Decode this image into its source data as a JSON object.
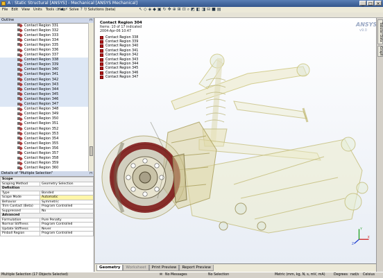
{
  "window": {
    "title": "A : Static Structural [ANSYS] - Mechanical [ANSYS Mechanical]",
    "buttons": [
      "_",
      "□",
      "×"
    ]
  },
  "menubar": [
    "File",
    "Edit",
    "View",
    "Units",
    "Tools",
    "Help"
  ],
  "toolbar": {
    "solve_label": "Solve",
    "solutions_label": "?/ Solutions (beta)"
  },
  "outline": {
    "header": "Outline",
    "items": [
      "Contact Region 331",
      "Contact Region 332",
      "Contact Region 333",
      "Contact Region 334",
      "Contact Region 335",
      "Contact Region 336",
      "Contact Region 337",
      "Contact Region 338",
      "Contact Region 339",
      "Contact Region 340",
      "Contact Region 341",
      "Contact Region 342",
      "Contact Region 343",
      "Contact Region 344",
      "Contact Region 345",
      "Contact Region 346",
      "Contact Region 347",
      "Contact Region 348",
      "Contact Region 349",
      "Contact Region 350",
      "Contact Region 351",
      "Contact Region 352",
      "Contact Region 353",
      "Contact Region 354",
      "Contact Region 355",
      "Contact Region 356",
      "Contact Region 357",
      "Contact Region 358",
      "Contact Region 359",
      "Contact Region 360"
    ],
    "selected_from": 7,
    "selected_to": 16
  },
  "details": {
    "header": "Details of \"Multiple Selection\"",
    "rows": [
      {
        "section": "Scope"
      },
      {
        "k": "Scoping Method",
        "v": "Geometry Selection"
      },
      {
        "section": "Definition"
      },
      {
        "k": "Type",
        "v": "Bonded"
      },
      {
        "k": "Scope Mode",
        "v": "Automatic"
      },
      {
        "k": "Behavior",
        "v": "Symmetric"
      },
      {
        "k": "Trim Contact (Beta)",
        "v": "Program Controlled"
      },
      {
        "k": "Suppressed",
        "v": "No"
      },
      {
        "section": "Advanced"
      },
      {
        "k": "Formulation",
        "v": "Pure Penalty"
      },
      {
        "k": "Normal Stiffness",
        "v": "Program Controlled"
      },
      {
        "k": "Update Stiffness",
        "v": "Never"
      },
      {
        "k": "Pinball Region",
        "v": "Program Controlled"
      }
    ]
  },
  "viewport": {
    "legend_title": "Contact Region 304",
    "legend_sub1": "Items: 10 of 17 indicated",
    "legend_sub2": "2004-Apr-06 10:47",
    "legend_items": [
      "Contact Region 338",
      "Contact Region 339",
      "Contact Region 340",
      "Contact Region 341",
      "Contact Region 342",
      "Contact Region 343",
      "Contact Region 344",
      "Contact Region 345",
      "Contact Region 346",
      "Contact Region 347"
    ],
    "logo": "ANSYS",
    "logo_sub": "v9.0",
    "triad_labels": [
      "X",
      "Y",
      "Z"
    ]
  },
  "right_tabs": [
    "Tabular Data",
    "Graph"
  ],
  "bottom_tabs": [
    "Geometry",
    "Worksheet",
    "Print Preview",
    "Report Preview"
  ],
  "status": {
    "selection": "Multiple Selection (17 Objects Selected)",
    "messages": "No Messages",
    "no_selection": "No Selection",
    "units": "Metric (mm, kg, N, s, mV, mA)",
    "angle": "Degrees",
    "rate": "rad/s",
    "temp": "Celsius"
  },
  "colors": {
    "accent": "#33558c",
    "highlight": "#b01818",
    "model": "#c8c070"
  }
}
